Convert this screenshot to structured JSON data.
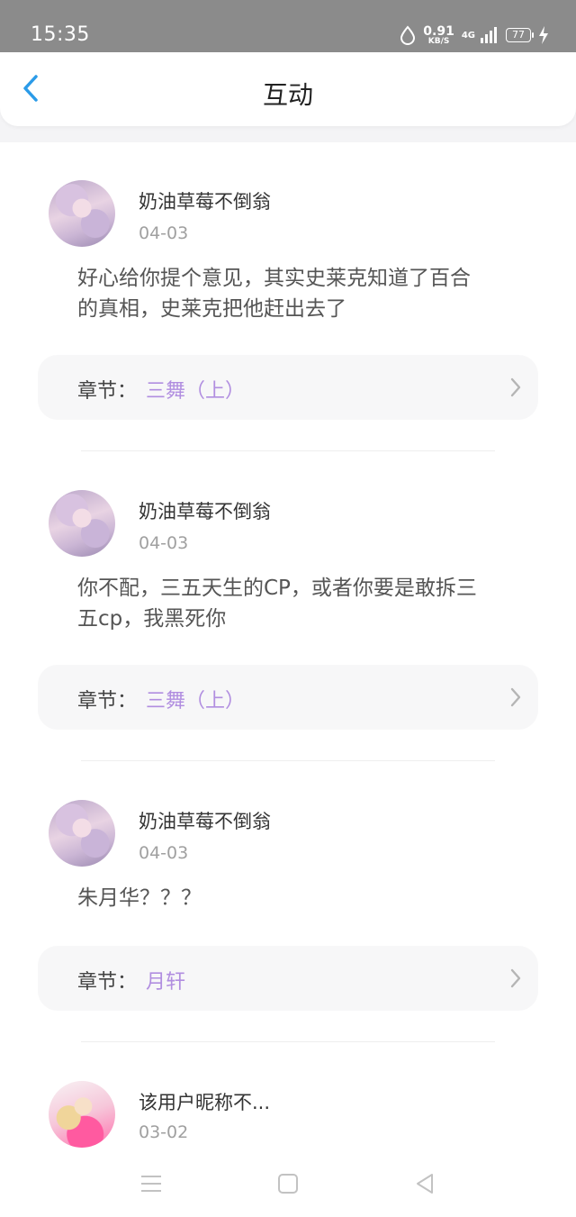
{
  "status_bar": {
    "time": "15:35",
    "speed_value": "0.91",
    "speed_unit": "KB/S",
    "network": "4G",
    "battery": "77",
    "icons": [
      "water-drop-icon",
      "signal-icon",
      "battery-icon",
      "charging-bolt-icon"
    ]
  },
  "header": {
    "title": "互动",
    "back_icon": "chevron-left-icon",
    "accent_color": "#2b9be8"
  },
  "colors": {
    "chapter_name": "#b18ee0",
    "date": "#a0a0a0"
  },
  "posts": [
    {
      "username": "奶油草莓不倒翁",
      "date": "04-03",
      "comment_line1": "好心给你提个意见，其实史莱克知道了百合",
      "comment_line2": "的真相，史莱克把他赶出去了",
      "chapter_label": "章节：",
      "chapter_name": "三舞（上）"
    },
    {
      "username": "奶油草莓不倒翁",
      "date": "04-03",
      "comment_line1": "你不配，三五天生的CP，或者你要是敢拆三",
      "comment_line2": "五cp，我黑死你",
      "chapter_label": "章节：",
      "chapter_name": "三舞（上）"
    },
    {
      "username": "奶油草莓不倒翁",
      "date": "04-03",
      "comment_line1": "朱月华？？？",
      "comment_line2": "",
      "chapter_label": "章节：",
      "chapter_name": "月轩"
    },
    {
      "username": "该用户昵称不...",
      "date": "03-02"
    }
  ],
  "nav_bar": {
    "icons": [
      "menu-icon",
      "home-square-icon",
      "back-triangle-icon"
    ]
  }
}
